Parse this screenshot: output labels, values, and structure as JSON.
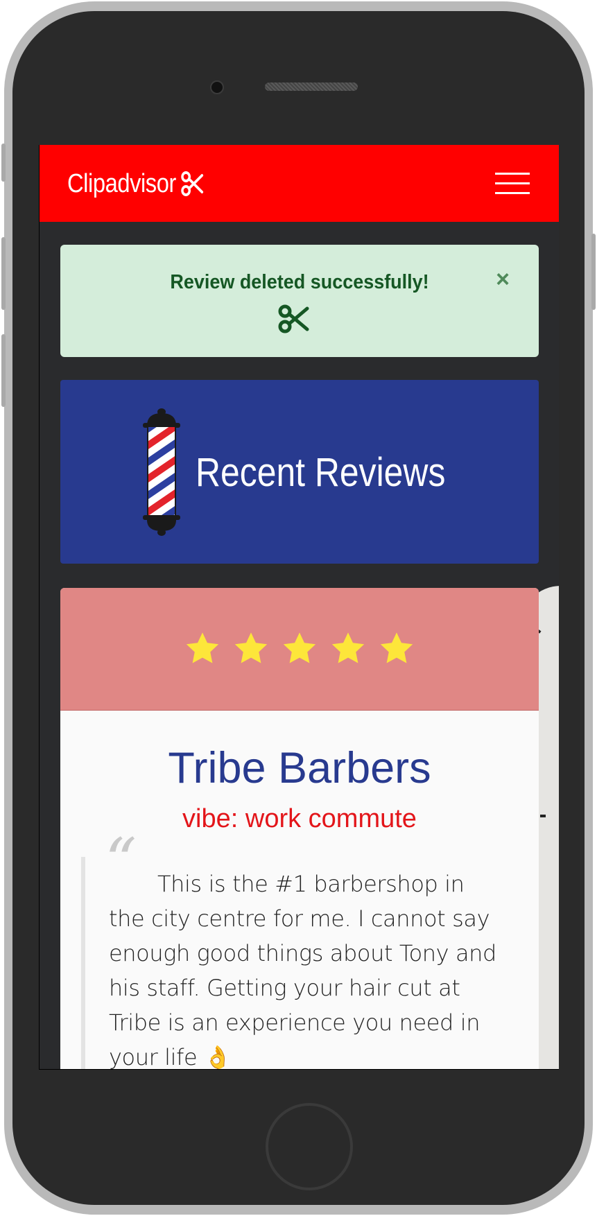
{
  "navbar": {
    "brand": "Clipadvisor",
    "brand_icon": "scissors-icon",
    "menu_icon": "hamburger-menu-icon"
  },
  "alert": {
    "message": "Review deleted successfully!",
    "icon": "scissors-icon",
    "close_label": "×",
    "background": "#d4edda",
    "text_color": "#155724"
  },
  "hero": {
    "title": "Recent Reviews",
    "icon": "barber-pole-icon",
    "background": "#283a8f"
  },
  "review": {
    "rating": 5,
    "rating_max": 5,
    "shop_name": "Tribe Barbers",
    "vibe": "vibe: work commute",
    "quote_mark": "“",
    "text": "This is the #1 barbershop in the city centre for me. I cannot say enough good things about Tony and his staff. Getting your hair cut at Tribe is an experience you need in your life 👌",
    "header_background": "#e08785",
    "star_color": "#fde63a"
  },
  "colors": {
    "accent_red": "#ff0000",
    "brand_blue": "#283a8f"
  }
}
